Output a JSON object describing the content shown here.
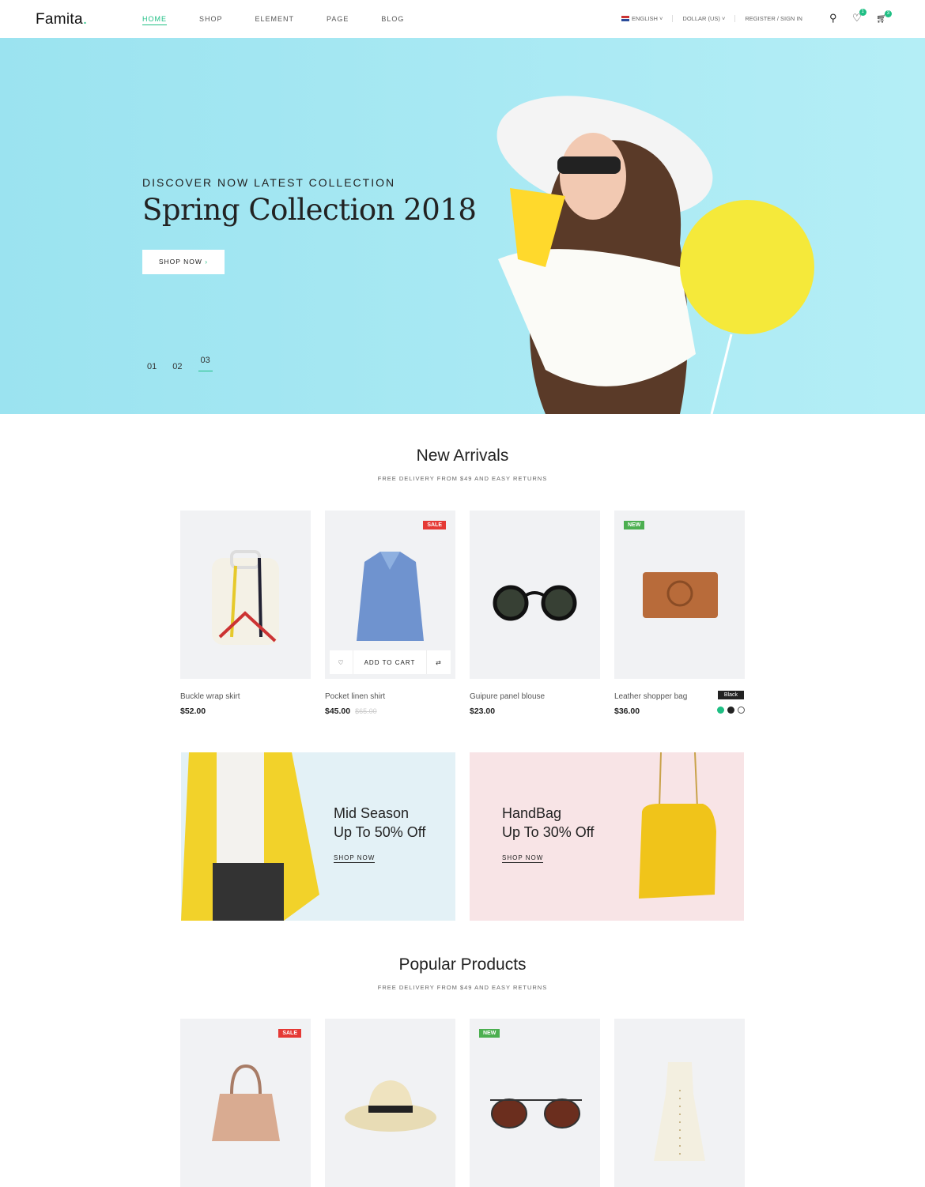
{
  "header": {
    "logo": "Famita",
    "logo_dot": ".",
    "nav": [
      "HOME",
      "SHOP",
      "ELEMENT",
      "PAGE",
      "BLOG"
    ],
    "language": "ENGLISH",
    "currency": "DOLLAR (US)",
    "account": "REGISTER / SIGN IN",
    "wishlist_count": "1",
    "cart_count": "3"
  },
  "hero": {
    "subtitle": "DISCOVER NOW LATEST COLLECTION",
    "title": "Spring Collection 2018",
    "button": "SHOP NOW",
    "slides": [
      "01",
      "02",
      "03"
    ],
    "active_slide": "03"
  },
  "new_arrivals": {
    "title": "New Arrivals",
    "subtitle": "FREE DELIVERY FROM $49 AND EASY RETURNS",
    "products": [
      {
        "name": "Buckle wrap skirt",
        "price": "$52.00"
      },
      {
        "name": "Pocket linen shirt",
        "price": "$45.00",
        "old_price": "$65.00",
        "badge": "SALE",
        "action": "ADD TO CART"
      },
      {
        "name": "Guipure panel blouse",
        "price": "$23.00"
      },
      {
        "name": "Leather shopper bag",
        "price": "$36.00",
        "badge": "NEW",
        "tooltip": "Black",
        "swatches": [
          "#1fbf84",
          "#222222",
          "#ffffff"
        ]
      }
    ]
  },
  "banners": [
    {
      "line1": "Mid Season",
      "line2": "Up To 50% Off",
      "link": "SHOP NOW"
    },
    {
      "line1": "HandBag",
      "line2": "Up To 30% Off",
      "link": "SHOP NOW"
    }
  ],
  "popular": {
    "title": "Popular Products",
    "subtitle": "FREE DELIVERY FROM $49 AND EASY RETURNS",
    "badges": [
      "SALE",
      "NEW"
    ]
  },
  "colors": {
    "accent": "#1fbf84",
    "sale": "#e53935",
    "new": "#4caf50"
  }
}
